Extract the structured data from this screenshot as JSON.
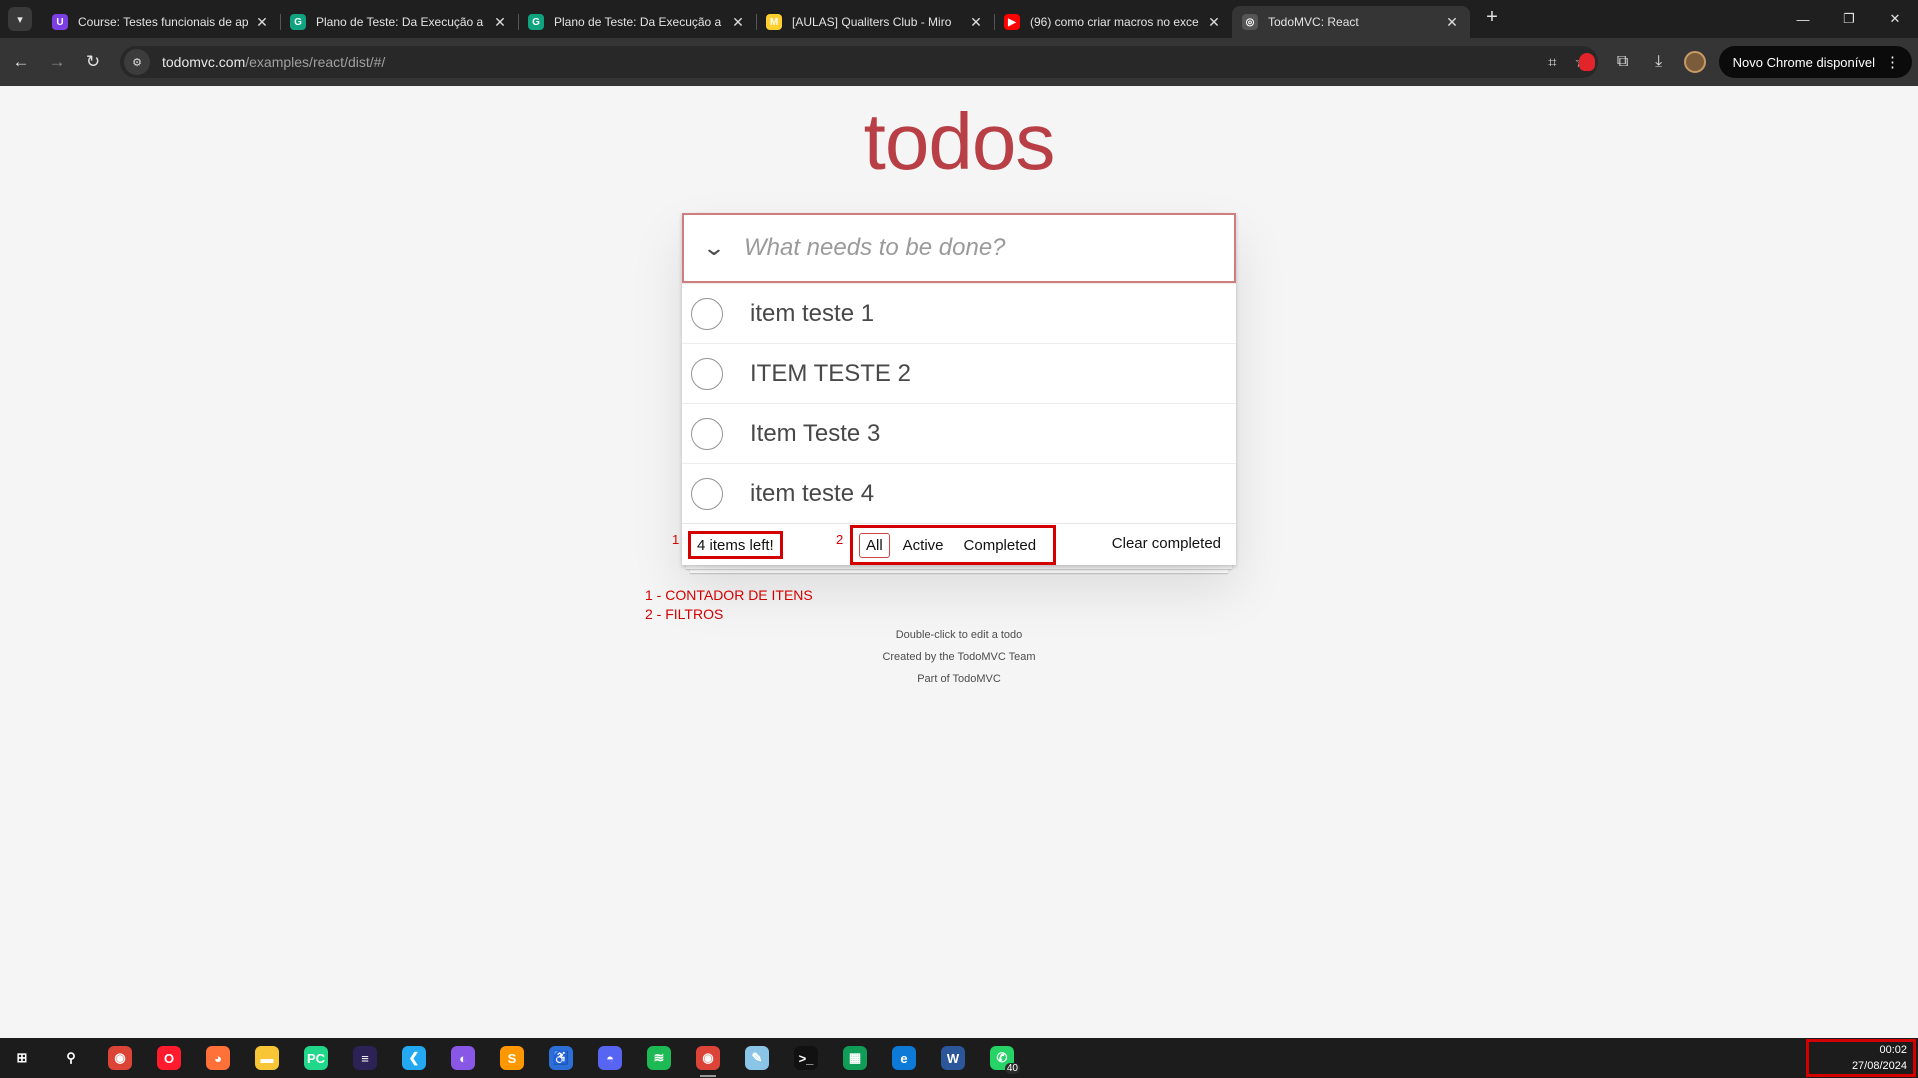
{
  "browser": {
    "tabs": [
      {
        "title": "Course: Testes funcionais de ap",
        "favicon": "course-icon",
        "color": "#7b3fe4",
        "glyph": "U",
        "active": false
      },
      {
        "title": "Plano de Teste: Da Execução a A",
        "favicon": "chatgpt-icon",
        "color": "#10a37f",
        "glyph": "G",
        "active": false
      },
      {
        "title": "Plano de Teste: Da Execução a A",
        "favicon": "chatgpt-icon",
        "color": "#10a37f",
        "glyph": "G",
        "active": false
      },
      {
        "title": "[AULAS] Qualiters Club - Miro",
        "favicon": "miro-icon",
        "color": "#ffd02f",
        "glyph": "M",
        "active": false
      },
      {
        "title": "(96) como criar macros no exce",
        "favicon": "youtube-icon",
        "color": "#ff0000",
        "glyph": "▶",
        "active": false
      },
      {
        "title": "TodoMVC: React",
        "favicon": "globe-icon",
        "color": "#555555",
        "glyph": "◎",
        "active": true
      }
    ],
    "url_host": "todomvc.com",
    "url_path": "/examples/react/dist/#/",
    "update_label": "Novo Chrome disponível"
  },
  "app": {
    "title": "todos",
    "placeholder": "What needs to be done?",
    "todos": [
      {
        "label": "item teste 1",
        "completed": false
      },
      {
        "label": "ITEM TESTE 2",
        "completed": false
      },
      {
        "label": "Item Teste 3",
        "completed": false
      },
      {
        "label": "item teste 4",
        "completed": false
      }
    ],
    "count_label": "4 items left!",
    "filters": [
      {
        "label": "All",
        "selected": true
      },
      {
        "label": "Active",
        "selected": false
      },
      {
        "label": "Completed",
        "selected": false
      }
    ],
    "clear_label": "Clear completed",
    "accent_color": "#b83f45"
  },
  "annotations": {
    "marker_1": "1",
    "marker_2": "2",
    "note_1": "1 - CONTADOR DE ITENS",
    "note_2": "2 - FILTROS",
    "color": "#d40000"
  },
  "info": {
    "line1": "Double-click to edit a todo",
    "line2": "Created by the TodoMVC Team",
    "line3": "Part of TodoMVC"
  },
  "taskbar": {
    "apps": [
      {
        "name": "windows-start-icon",
        "color": "#1c1c1c",
        "glyph": "⊞",
        "open": false
      },
      {
        "name": "search-icon",
        "color": "#1c1c1c",
        "glyph": "⚲",
        "open": false
      },
      {
        "name": "chrome-icon",
        "color": "#db4437",
        "glyph": "◉",
        "open": false
      },
      {
        "name": "opera-icon",
        "color": "#ff1b2d",
        "glyph": "O",
        "open": false
      },
      {
        "name": "firefox-icon",
        "color": "#ff7139",
        "glyph": "◕",
        "open": false
      },
      {
        "name": "file-explorer-icon",
        "color": "#f8c537",
        "glyph": "▬",
        "open": false
      },
      {
        "name": "pycharm-icon",
        "color": "#21d789",
        "glyph": "PC",
        "open": false
      },
      {
        "name": "eclipse-icon",
        "color": "#2c2255",
        "glyph": "≡",
        "open": false
      },
      {
        "name": "vscode-icon",
        "color": "#23a9f2",
        "glyph": "❮",
        "open": false
      },
      {
        "name": "github-desktop-icon",
        "color": "#8957e5",
        "glyph": "◐",
        "open": false
      },
      {
        "name": "sublime-icon",
        "color": "#ff9800",
        "glyph": "S",
        "open": false
      },
      {
        "name": "accessibility-icon",
        "color": "#2d6fd6",
        "glyph": "♿",
        "open": false
      },
      {
        "name": "discord-icon",
        "color": "#5865f2",
        "glyph": "◓",
        "open": false
      },
      {
        "name": "spotify-icon",
        "color": "#1db954",
        "glyph": "≋",
        "open": false
      },
      {
        "name": "chrome-profile-icon",
        "color": "#db4437",
        "glyph": "◉",
        "open": true
      },
      {
        "name": "notepad-icon",
        "color": "#8ac4e6",
        "glyph": "✎",
        "open": false
      },
      {
        "name": "terminal-icon",
        "color": "#111111",
        "glyph": ">_",
        "open": false
      },
      {
        "name": "sheets-icon",
        "color": "#0f9d58",
        "glyph": "▦",
        "open": false
      },
      {
        "name": "edge-icon",
        "color": "#0c7ad6",
        "glyph": "e",
        "open": false
      },
      {
        "name": "word-icon",
        "color": "#2b579a",
        "glyph": "W",
        "open": false
      },
      {
        "name": "whatsapp-icon",
        "color": "#25d366",
        "glyph": "✆",
        "open": false,
        "badge": "40"
      }
    ],
    "time": "00:02",
    "date": "27/08/2024"
  }
}
